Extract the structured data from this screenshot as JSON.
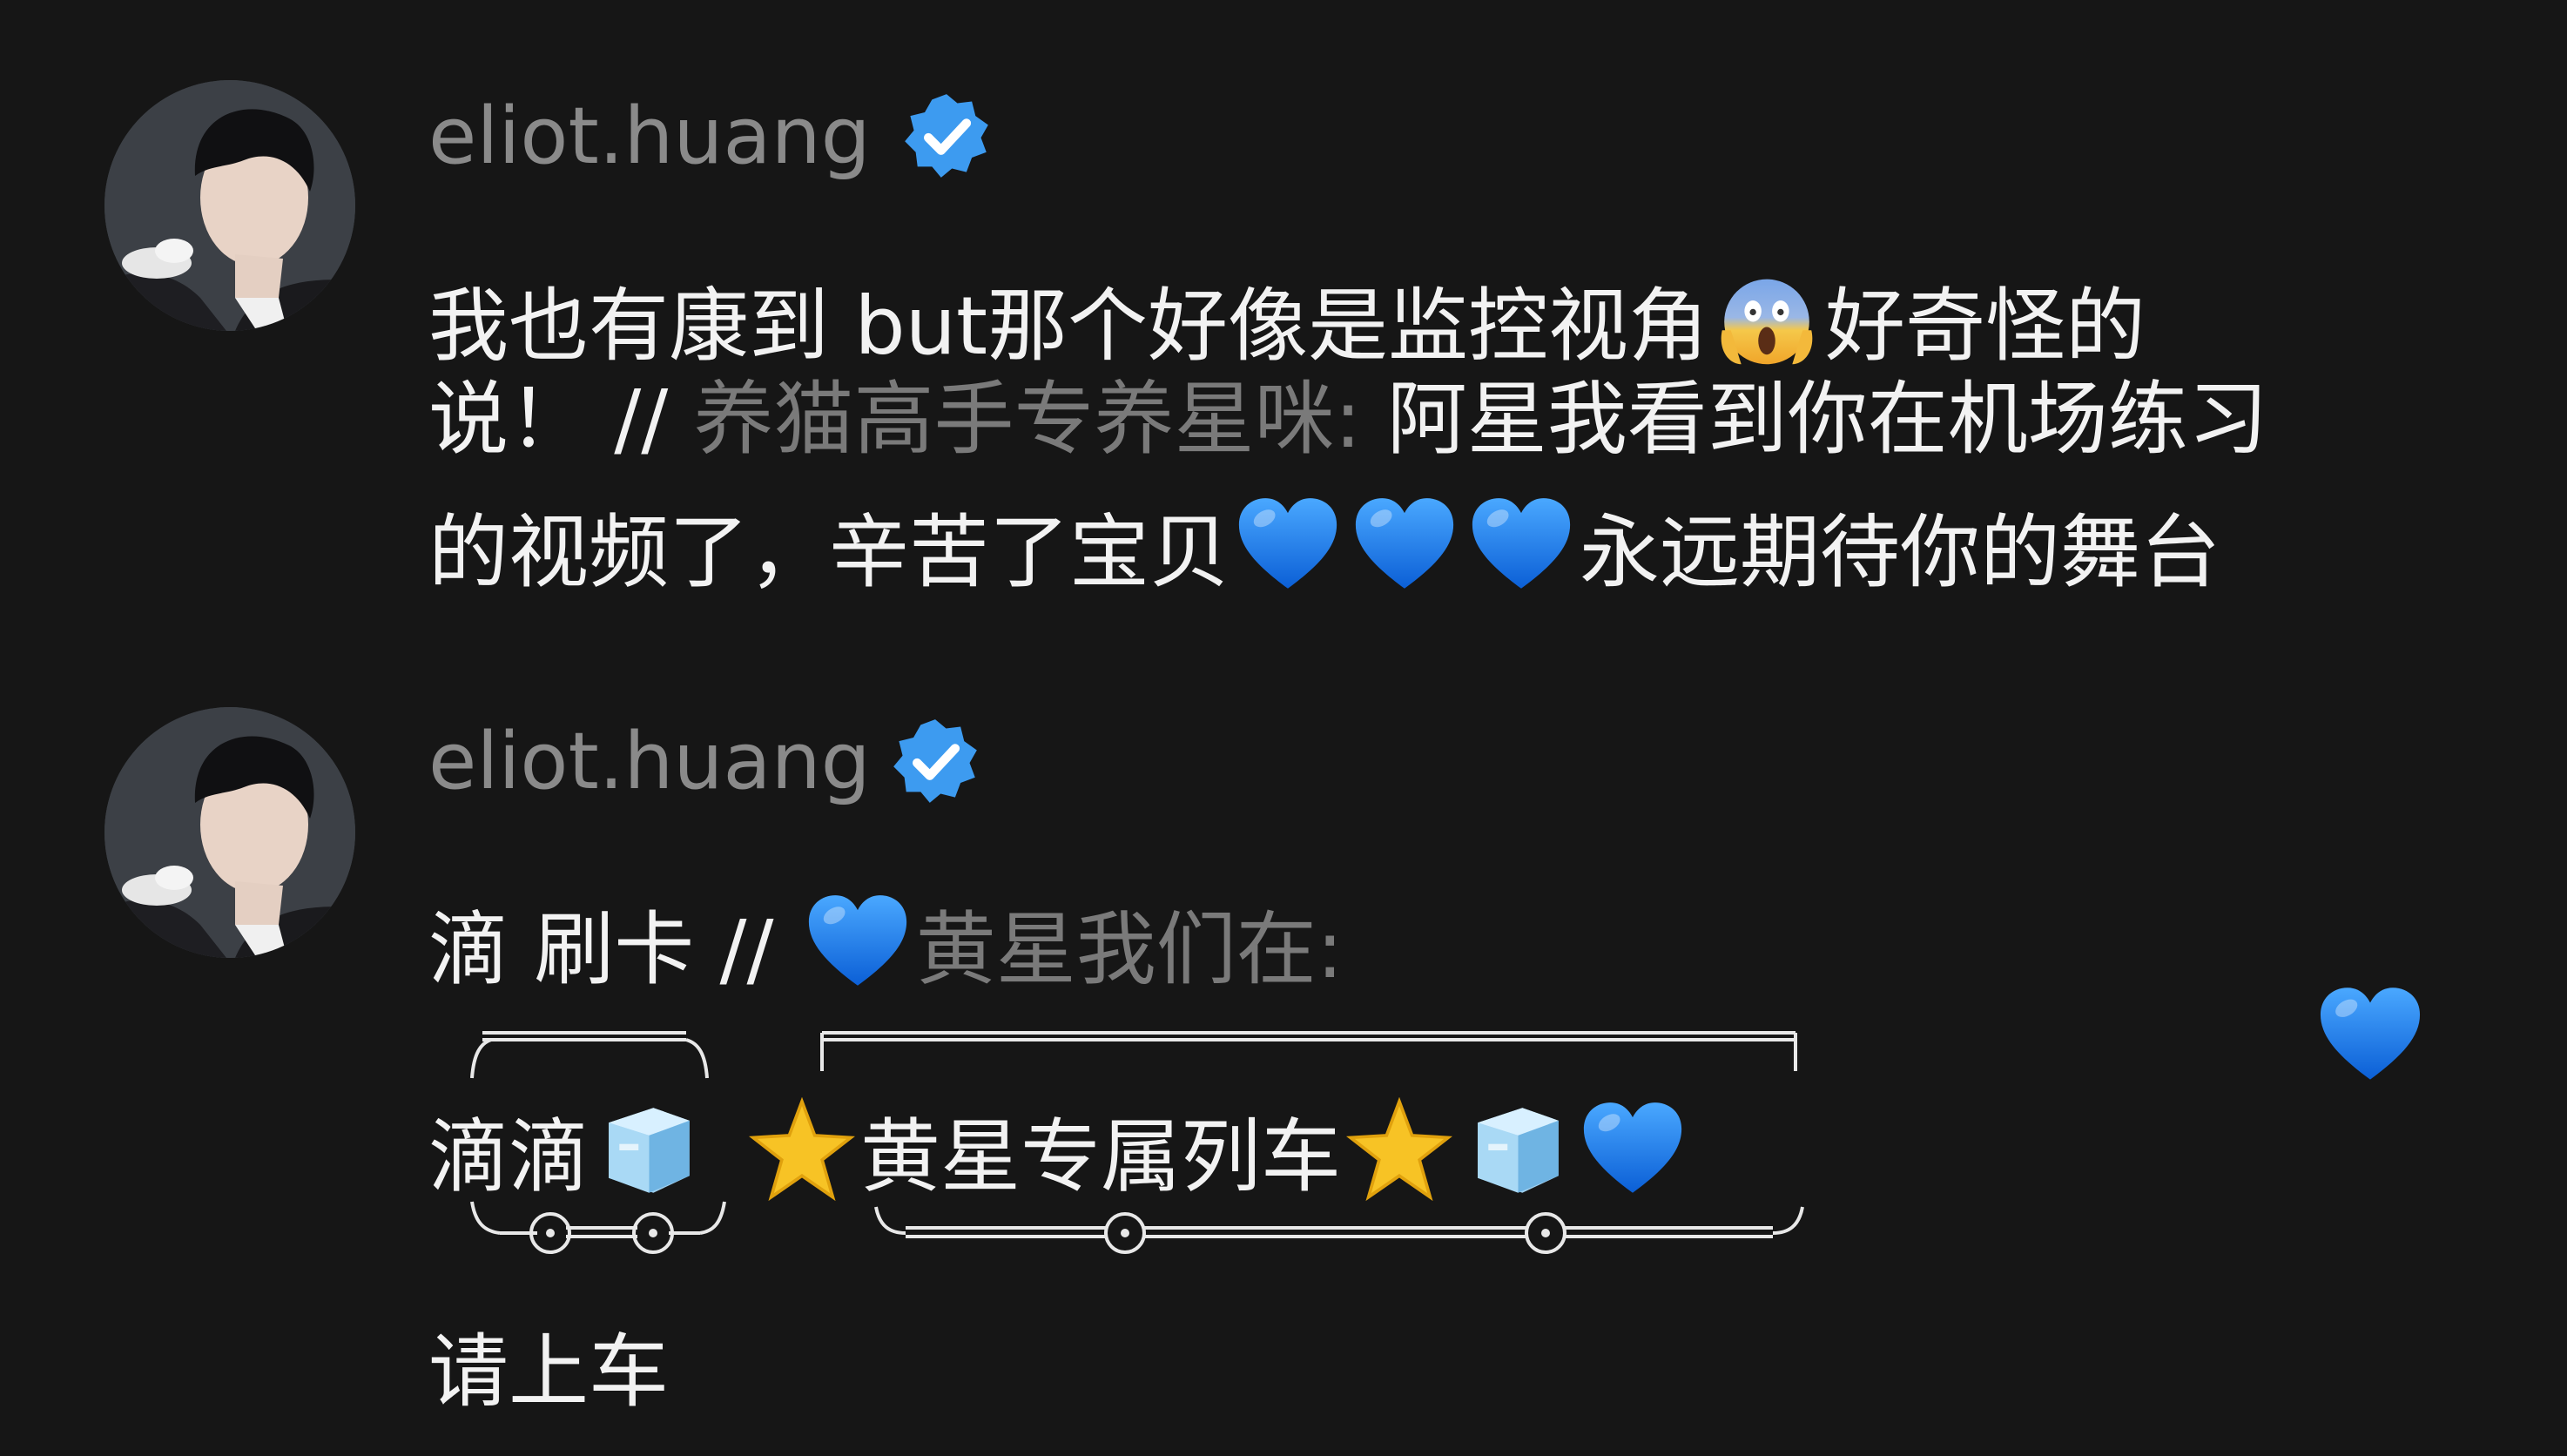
{
  "comments": [
    {
      "username": "eliot.huang",
      "verified_icon": "verified-badge-icon",
      "text_line1": "我也有康到 but那个好像是监控视角",
      "text_line1b": "好奇怪的",
      "text_line2_a": "说！ // ",
      "text_line2_quote": "养猫高手专养星咪:",
      "text_line2_b": " 阿星我看到你在机场练习",
      "text_line3_a": "的视频了，辛苦了宝贝",
      "text_line3_b": "永远期待你的舞台"
    },
    {
      "username": "eliot.huang",
      "verified_icon": "verified-badge-icon",
      "text_line1_a": "滴 刷卡 // ",
      "text_line1_quote": "黄星我们在:",
      "train_car1": "滴滴",
      "train_car2": "黄星专属列车",
      "text_last": "请上车"
    }
  ],
  "icons": {
    "scream": "screaming-face-emoji",
    "heart": "blue-heart-emoji",
    "ice": "ice-cube-emoji",
    "star": "star-emoji"
  },
  "colors": {
    "background": "#161616",
    "username": "#8a8a8a",
    "text": "#f2f2f2",
    "quote": "#7a7a7a",
    "verified": "#3d9bf0",
    "heart": "#1f7cf2"
  }
}
